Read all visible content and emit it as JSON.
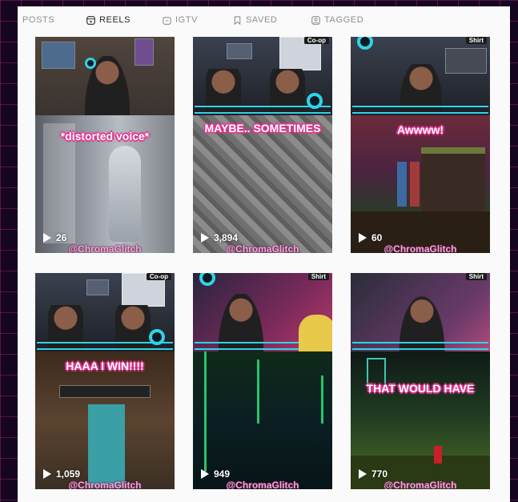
{
  "tabs": [
    {
      "label": "POSTS",
      "icon": "grid-icon",
      "active": false
    },
    {
      "label": "REELS",
      "icon": "reels-icon",
      "active": true
    },
    {
      "label": "IGTV",
      "icon": "igtv-icon",
      "active": false
    },
    {
      "label": "SAVED",
      "icon": "bookmark-icon",
      "active": false
    },
    {
      "label": "TAGGED",
      "icon": "tagged-icon",
      "active": false
    }
  ],
  "reels": [
    {
      "caption": "*distorted voice*",
      "plays": "26",
      "handle": "@ChromaGlitch",
      "top_tag": ""
    },
    {
      "caption": "MAYBE.. SOMETIMES",
      "plays": "3,894",
      "handle": "@ChromaGlitch",
      "top_tag": "Co-op"
    },
    {
      "caption": "Awwww!",
      "plays": "60",
      "handle": "@ChromaGlitch",
      "top_tag": "Shirt"
    },
    {
      "caption": "HAAA I WIN!!!!",
      "plays": "1,059",
      "handle": "@ChromaGlitch",
      "top_tag": "Co-op"
    },
    {
      "caption": "",
      "plays": "949",
      "handle": "@ChromaGlitch",
      "top_tag": "Shirt"
    },
    {
      "caption": "THAT WOULD HAVE",
      "plays": "770",
      "handle": "@ChromaGlitch",
      "top_tag": "Shirt"
    }
  ],
  "colors": {
    "accent_cyan": "#2fd3e8",
    "caption_outline": "#e0358f",
    "active_tab": "#262626",
    "inactive_tab": "#8e8e8e"
  }
}
